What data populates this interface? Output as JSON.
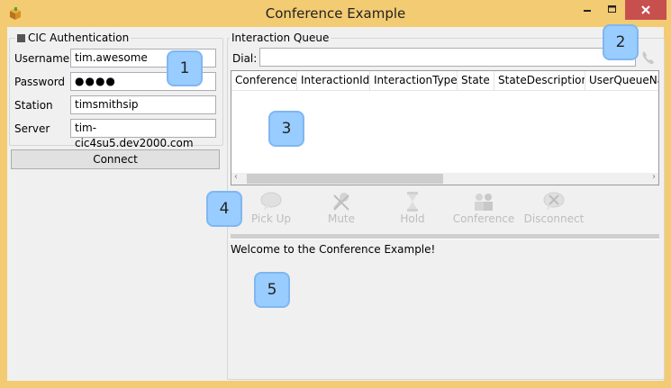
{
  "window": {
    "title": "Conference Example",
    "icons": {
      "app": "box-icon",
      "minimize": "minimize-icon",
      "maximize": "maximize-icon",
      "close": "close-icon"
    }
  },
  "auth": {
    "legend": "CIC Authentication",
    "username_label": "Username",
    "username_value": "tim.awesome",
    "password_label": "Password",
    "password_value": "●●●●",
    "station_label": "Station",
    "station_value": "timsmithsip",
    "server_label": "Server",
    "server_value": "tim-cic4su5.dev2000.com",
    "connect_label": "Connect"
  },
  "queue": {
    "legend": "Interaction Queue",
    "dial_label": "Dial:",
    "dial_value": "",
    "columns": [
      "Conference",
      "InteractionId",
      "InteractionType",
      "State",
      "StateDescription",
      "UserQueueNa"
    ]
  },
  "toolbar": {
    "pickup": "Pick Up",
    "mute": "Mute",
    "hold": "Hold",
    "conference": "Conference",
    "disconnect": "Disconnect"
  },
  "log": {
    "text": "Welcome to the Conference Example!"
  },
  "badges": [
    "1",
    "2",
    "3",
    "4",
    "5"
  ]
}
